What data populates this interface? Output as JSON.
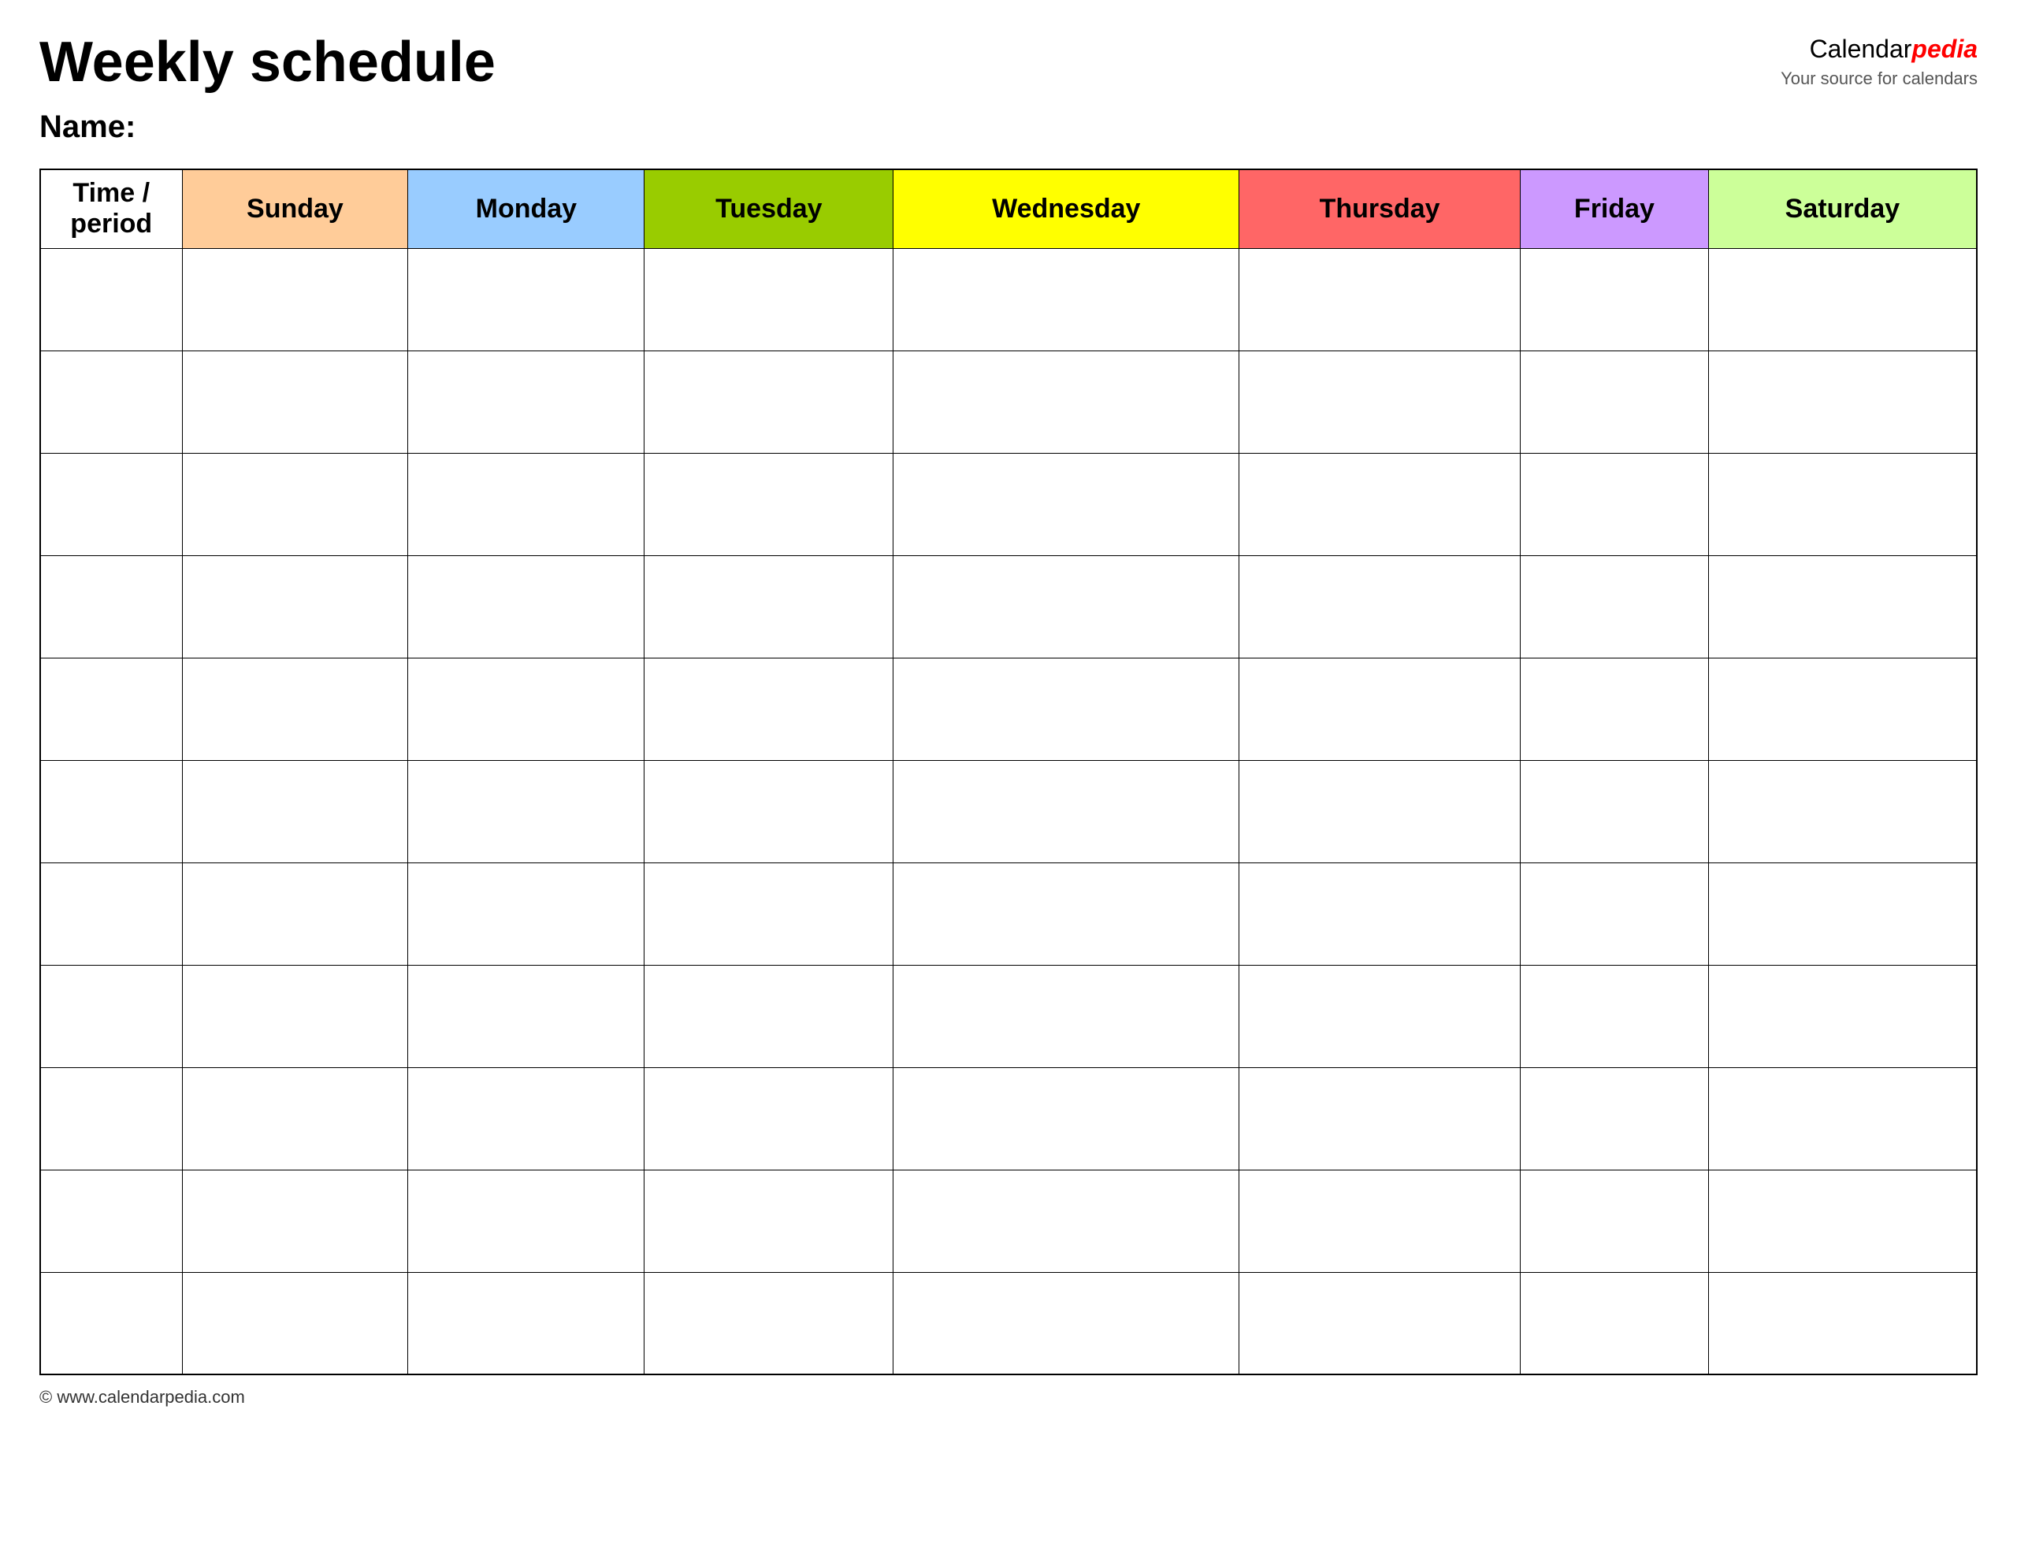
{
  "header": {
    "title": "Weekly schedule",
    "name_label": "Name:"
  },
  "brand": {
    "calendar": "Calendar",
    "pedia": "pedia",
    "tagline": "Your source for calendars"
  },
  "table": {
    "columns": [
      {
        "id": "time",
        "label": "Time / period",
        "class": ""
      },
      {
        "id": "sunday",
        "label": "Sunday",
        "class": "col-sunday"
      },
      {
        "id": "monday",
        "label": "Monday",
        "class": "col-monday"
      },
      {
        "id": "tuesday",
        "label": "Tuesday",
        "class": "col-tuesday"
      },
      {
        "id": "wednesday",
        "label": "Wednesday",
        "class": "col-wednesday"
      },
      {
        "id": "thursday",
        "label": "Thursday",
        "class": "col-thursday"
      },
      {
        "id": "friday",
        "label": "Friday",
        "class": "col-friday"
      },
      {
        "id": "saturday",
        "label": "Saturday",
        "class": "col-saturday"
      }
    ],
    "row_count": 11
  },
  "footer": {
    "copyright": "© www.calendarpedia.com"
  }
}
